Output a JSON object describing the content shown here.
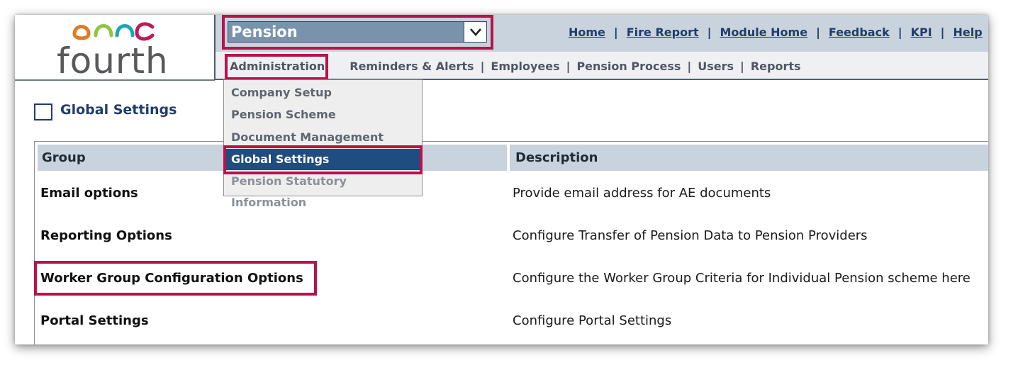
{
  "logo": {
    "text": "fourth"
  },
  "module_select": {
    "value": "Pension"
  },
  "top_links": [
    {
      "label": "Home"
    },
    {
      "label": "Fire Report"
    },
    {
      "label": "Module Home"
    },
    {
      "label": "Feedback"
    },
    {
      "label": "KPI"
    },
    {
      "label": "Help"
    }
  ],
  "nav": [
    {
      "label": "Administration"
    },
    {
      "label": "Reminders & Alerts"
    },
    {
      "label": "Employees"
    },
    {
      "label": "Pension Process"
    },
    {
      "label": "Users"
    },
    {
      "label": "Reports"
    }
  ],
  "separator": "|",
  "dropdown": [
    {
      "label": "Company Setup"
    },
    {
      "label": "Pension Scheme"
    },
    {
      "label": "Document Management"
    },
    {
      "label": "Global Settings"
    },
    {
      "label": "Pension Statutory Information"
    }
  ],
  "page": {
    "title": "Global Settings"
  },
  "table": {
    "headers": {
      "group": "Group",
      "description": "Description"
    },
    "rows": [
      {
        "group": "Email options",
        "description": "Provide email address for AE documents"
      },
      {
        "group": "Reporting Options",
        "description": "Configure Transfer of Pension Data to Pension Providers"
      },
      {
        "group": "Worker Group Configuration Options",
        "description": "Configure the Worker Group Criteria for Individual Pension scheme here"
      },
      {
        "group": "Portal Settings",
        "description": "Configure Portal Settings"
      }
    ]
  },
  "colors": {
    "highlight": "#b8134a",
    "header_band": "#c9d3dd",
    "select_fill": "#7a93ad",
    "active_menu": "#1f4c81",
    "link": "#1f3c6b"
  },
  "icons": {
    "logo_mark": "fourth-swirl-logo-icon",
    "dropdown_arrow": "chevron-down-icon",
    "title_icon": "square-outline-icon"
  }
}
